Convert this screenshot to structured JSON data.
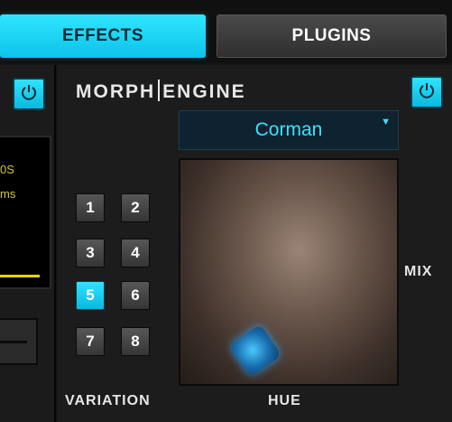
{
  "tabs": [
    {
      "label": "EFFECTS",
      "active": true
    },
    {
      "label": "PLUGINS",
      "active": false
    }
  ],
  "left_panel": {
    "readout_line1": "0S",
    "readout_line2": "ms",
    "power_icon": "power-icon"
  },
  "engine": {
    "title_left": "MORPH",
    "title_right": "ENGINE",
    "preset_value": "Corman",
    "preset_caret_icon": "triangle-down-icon",
    "power_icon": "power-icon",
    "variations": [
      "1",
      "2",
      "3",
      "4",
      "5",
      "6",
      "7",
      "8"
    ],
    "active_variation": "5",
    "variation_label": "VARIATION",
    "hue_label": "HUE",
    "mix_label": "MIX"
  },
  "colors": {
    "accent": "#1fd6f5",
    "panel": "#1c1c1c",
    "display_text": "#d6c43a"
  }
}
